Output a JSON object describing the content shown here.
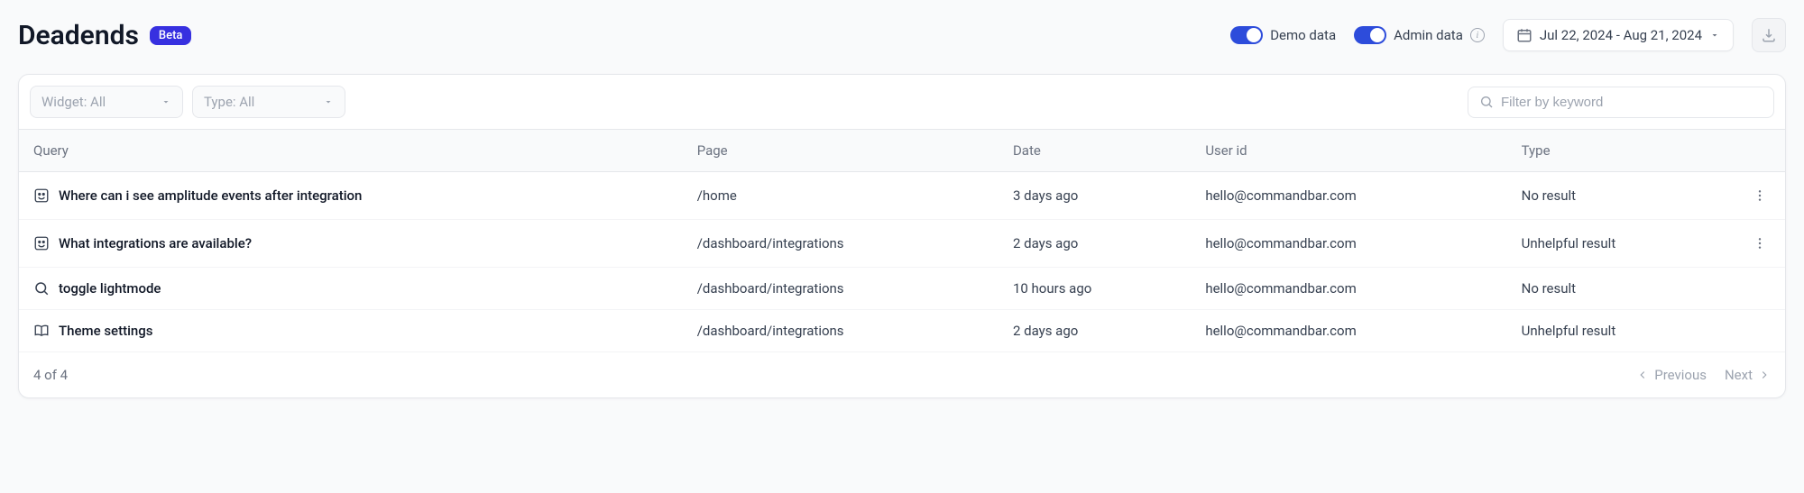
{
  "header": {
    "title": "Deadends",
    "badge": "Beta",
    "demo_toggle_label": "Demo data",
    "admin_toggle_label": "Admin data",
    "date_range": "Jul 22, 2024 - Aug 21, 2024"
  },
  "filters": {
    "widget_label": "Widget: All",
    "type_label": "Type: All",
    "search_placeholder": "Filter by keyword"
  },
  "table": {
    "headers": {
      "query": "Query",
      "page": "Page",
      "date": "Date",
      "user_id": "User id",
      "type": "Type"
    },
    "rows": [
      {
        "icon": "copilot",
        "query": "Where can i see amplitude events after integration",
        "page": "/home",
        "date": "3 days ago",
        "user_id": "hello@commandbar.com",
        "type": "No result",
        "has_actions": true
      },
      {
        "icon": "copilot",
        "query": "What integrations are available?",
        "page": "/dashboard/integrations",
        "date": "2 days ago",
        "user_id": "hello@commandbar.com",
        "type": "Unhelpful result",
        "has_actions": true
      },
      {
        "icon": "search",
        "query": "toggle lightmode",
        "page": "/dashboard/integrations",
        "date": "10 hours ago",
        "user_id": "hello@commandbar.com",
        "type": "No result",
        "has_actions": false
      },
      {
        "icon": "book",
        "query": "Theme settings",
        "page": "/dashboard/integrations",
        "date": "2 days ago",
        "user_id": "hello@commandbar.com",
        "type": "Unhelpful result",
        "has_actions": false
      }
    ]
  },
  "footer": {
    "count": "4 of 4",
    "previous": "Previous",
    "next": "Next"
  }
}
